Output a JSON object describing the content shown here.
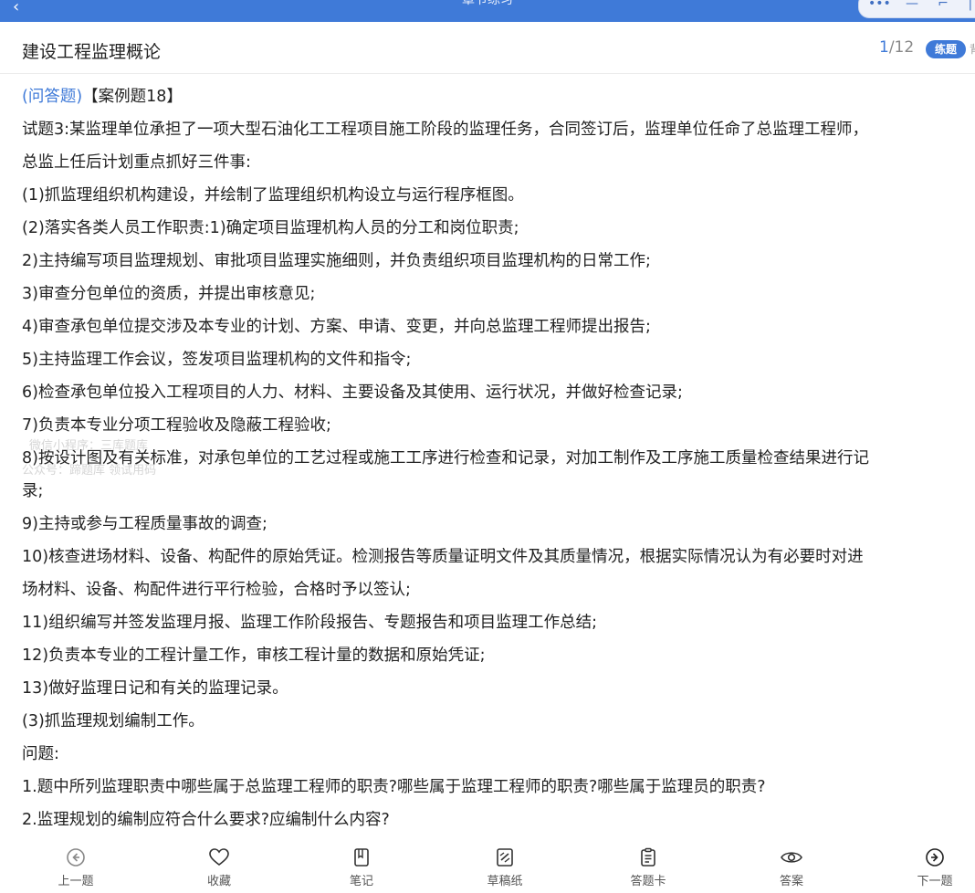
{
  "topbar": {
    "title": "章节练习"
  },
  "header": {
    "title": "建设工程监理概论",
    "progress_current": "1",
    "progress_total": "/12",
    "badge": "练题",
    "badge_edge": "背"
  },
  "question": {
    "type_label": "(问答题)",
    "case_label": "【案例题18】",
    "lines": [
      "试题3:某监理单位承担了一项大型石油化工工程项目施工阶段的监理任务，合同签订后，监理单位任命了总监理工程师，",
      "总监上任后计划重点抓好三件事:",
      "(1)抓监理组织机构建设，并绘制了监理组织机构设立与运行程序框图。",
      "(2)落实各类人员工作职责:1)确定项目监理机构人员的分工和岗位职责;",
      "2)主持编写项目监理规划、审批项目监理实施细则，并负责组织项目监理机构的日常工作;",
      "3)审查分包单位的资质，并提出审核意见;",
      "4)审查承包单位提交涉及本专业的计划、方案、申请、变更，并向总监理工程师提出报告;",
      "5)主持监理工作会议，签发项目监理机构的文件和指令;",
      "6)检查承包单位投入工程项目的人力、材料、主要设备及其使用、运行状况，并做好检查记录;",
      "7)负责本专业分项工程验收及隐蔽工程验收;",
      "8)按设计图及有关标准，对承包单位的工艺过程或施工工序进行检查和记录，对加工制作及工序施工质量检查结果进行记",
      "录;",
      "9)主持或参与工程质量事故的调查;",
      "10)核查进场材料、设备、构配件的原始凭证。检测报告等质量证明文件及其质量情况，根据实际情况认为有必要时对进",
      "场材料、设备、构配件进行平行检验，合格时予以签认;",
      "11)组织编写并签发监理月报、监理工作阶段报告、专题报告和项目监理工作总结;",
      "12)负责本专业的工程计量工作，审核工程计量的数据和原始凭证;",
      "13)做好监理日记和有关的监理记录。",
      "(3)抓监理规划编制工作。",
      "问题:",
      "1.题中所列监理职责中哪些属于总监理工程师的职责?哪些属于监理工程师的职责?哪些属于监理员的职责?",
      "2.监理规划的编制应符合什么要求?应编制什么内容?"
    ]
  },
  "watermark": {
    "line1": "微信小程序：三库题库",
    "line2": "公众号：蹄题库 领试用码"
  },
  "bottom_nav": {
    "prev": "上一题",
    "favorite": "收藏",
    "notes": "笔记",
    "scratch": "草稿纸",
    "answer_card": "答题卡",
    "answer": "答案",
    "next": "下一题"
  },
  "colors": {
    "accent": "#3f7ad8"
  }
}
